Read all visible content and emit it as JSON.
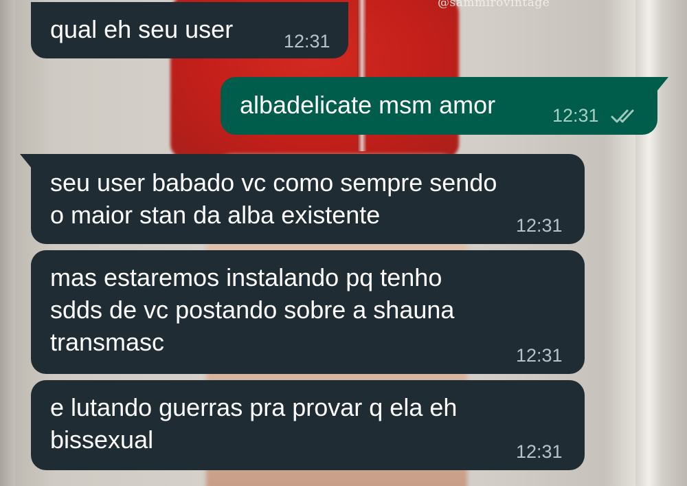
{
  "wallpaper": {
    "watermark": "@sammirovintage"
  },
  "colors": {
    "incoming_bubble": "#1f2c34",
    "outgoing_bubble": "#005c4b",
    "text": "#ffffff",
    "read_ticks": "#9ec9bd"
  },
  "messages": [
    {
      "direction": "incoming",
      "text": "qual eh seu user",
      "time": "12:31"
    },
    {
      "direction": "outgoing",
      "text": "albadelicate msm amor",
      "time": "12:31",
      "status_icon": "double-check-icon"
    },
    {
      "direction": "incoming",
      "text": "seu user babado vc como sempre sendo\no maior stan da alba existente",
      "time": "12:31"
    },
    {
      "direction": "incoming",
      "text": "mas estaremos instalando pq tenho\nsdds de vc postando sobre a shauna\ntransmasc",
      "time": "12:31"
    },
    {
      "direction": "incoming",
      "text": "e lutando guerras pra provar q ela eh\nbissexual",
      "time": "12:31"
    }
  ]
}
